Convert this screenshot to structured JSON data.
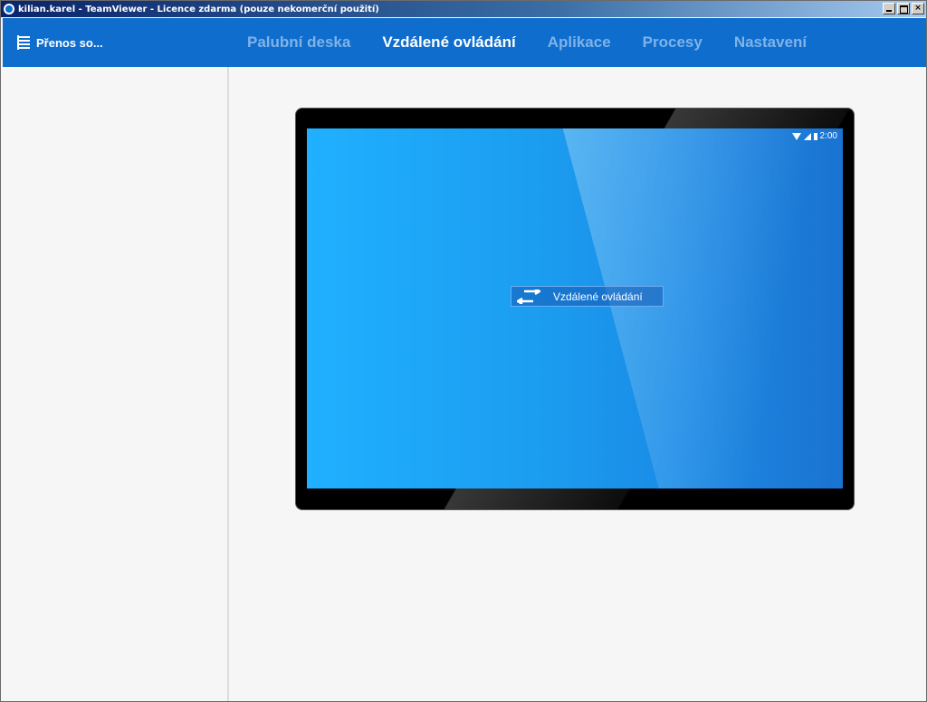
{
  "window": {
    "title": "kilian.karel - TeamViewer - Licence zdarma (pouze nekomerční použití)",
    "controls": {
      "minimize": "_",
      "maximize": "□",
      "close": "×"
    }
  },
  "navbar": {
    "file_transfer_label": "Přenos so...",
    "tabs": [
      {
        "label": "Palubní deska",
        "active": false
      },
      {
        "label": "Vzdálené ovládání",
        "active": true
      },
      {
        "label": "Aplikace",
        "active": false
      },
      {
        "label": "Procesy",
        "active": false
      },
      {
        "label": "Nastavení",
        "active": false
      }
    ]
  },
  "device": {
    "status_time": "2:00",
    "remote_control_label": "Vzdálené ovládání"
  },
  "colors": {
    "nav_background": "#0e6dcd",
    "tab_inactive": "#7fb3e9",
    "tab_active": "#ffffff",
    "screen_blue": "#1b9cef"
  }
}
